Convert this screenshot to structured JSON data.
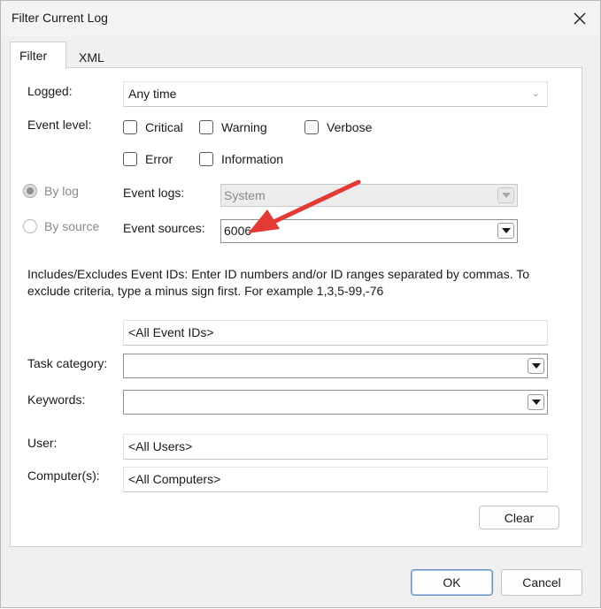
{
  "window": {
    "title": "Filter Current Log"
  },
  "tabs": [
    {
      "label": "Filter"
    },
    {
      "label": "XML"
    }
  ],
  "filter": {
    "logged": {
      "label": "Logged:",
      "value": "Any time"
    },
    "event_level": {
      "label": "Event level:",
      "options": [
        {
          "label": "Critical",
          "checked": false
        },
        {
          "label": "Warning",
          "checked": false
        },
        {
          "label": "Verbose",
          "checked": false
        },
        {
          "label": "Error",
          "checked": false
        },
        {
          "label": "Information",
          "checked": false
        }
      ]
    },
    "by_log": {
      "label": "By log",
      "selected": true
    },
    "by_source": {
      "label": "By source",
      "selected": false
    },
    "event_logs": {
      "label": "Event logs:",
      "value": "System"
    },
    "event_sources": {
      "label": "Event sources:",
      "value": "6006"
    },
    "note": "Includes/Excludes Event IDs: Enter ID numbers and/or ID ranges separated by commas. To exclude criteria, type a minus sign first. For example 1,3,5-99,-76",
    "event_ids": {
      "value": "<All Event IDs>"
    },
    "task_category": {
      "label": "Task category:",
      "value": ""
    },
    "keywords": {
      "label": "Keywords:",
      "value": ""
    },
    "user": {
      "label": "User:",
      "value": "<All Users>"
    },
    "computer": {
      "label": "Computer(s):",
      "value": "<All Computers>"
    },
    "clear_label": "Clear"
  },
  "buttons": {
    "ok": "OK",
    "cancel": "Cancel"
  },
  "annotation": {
    "arrow_color": "#e53935"
  }
}
